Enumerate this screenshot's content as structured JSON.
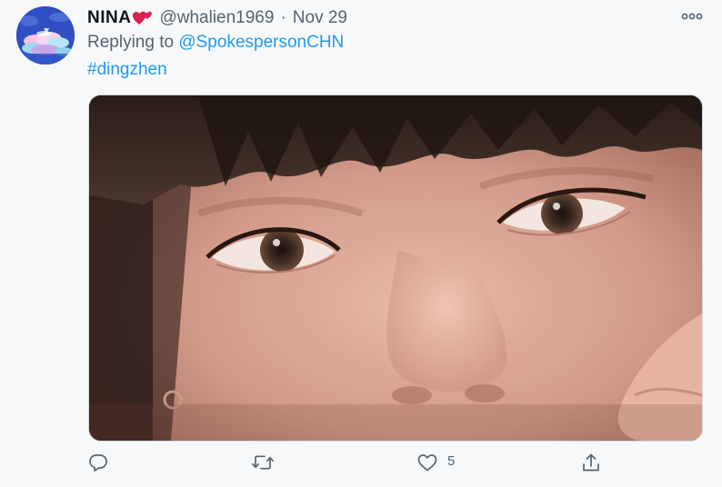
{
  "tweet": {
    "display_name": "NINA",
    "name_emoji": "heart-emoji",
    "handle": "@whalien1969",
    "separator": "·",
    "date": "Nov 29",
    "replying_prefix": "Replying to ",
    "replying_to": "@SpokespersonCHN",
    "hashtag": "#dingzhen",
    "media_alt": "close-up photo of a face"
  },
  "actions": {
    "reply_icon": "reply-icon",
    "retweet_icon": "retweet-icon",
    "like_icon": "heart-outline-icon",
    "like_count": "5",
    "share_icon": "share-icon"
  },
  "icons": {
    "more": "more-options-icon"
  },
  "colors": {
    "link": "#1d9bf0",
    "secondary_text": "#536471",
    "primary_text": "#0f1419",
    "background": "#f7f8f9",
    "heart_emoji": "#e0245e"
  }
}
